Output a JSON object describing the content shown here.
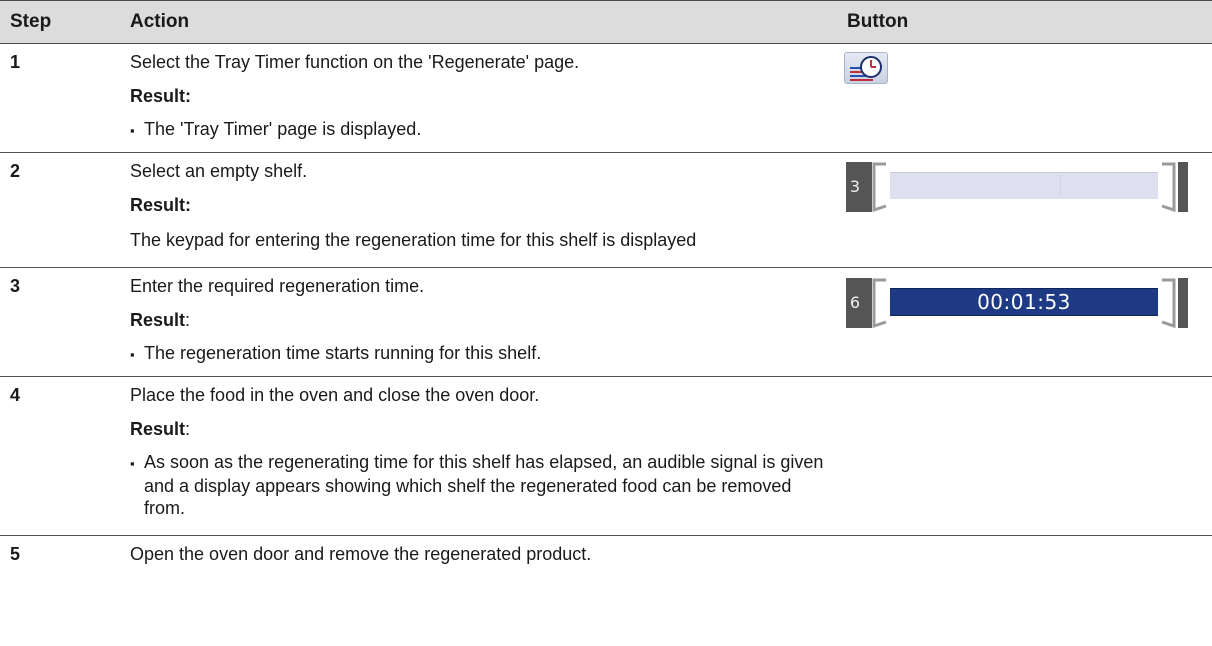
{
  "header": {
    "step": "Step",
    "action": "Action",
    "button": "Button"
  },
  "steps": [
    {
      "num": "1",
      "action": "Select the Tray Timer function on the 'Regenerate' page.",
      "result_label": "Result:",
      "result_suffix": "",
      "result_text": "The 'Tray Timer' page is displayed.",
      "icon": "tray-timer-icon"
    },
    {
      "num": "2",
      "action": "Select an empty shelf.",
      "result_label": "Result:",
      "result_suffix": "",
      "result_text": "The keypad for entering the regeneration time for this shelf is displayed",
      "shelf_label": "3",
      "icon": "empty-shelf-button"
    },
    {
      "num": "3",
      "action": "Enter the required regeneration time.",
      "result_label": "Result",
      "result_suffix": ":",
      "result_text": "The regeneration time starts running for this shelf.",
      "shelf_label": "6",
      "shelf_time": "00:01:53",
      "icon": "running-shelf-button"
    },
    {
      "num": "4",
      "action": "Place the food in the oven and close the oven door.",
      "result_label": "Result",
      "result_suffix": ":",
      "result_text": "As soon as the regenerating time for this shelf has elapsed, an audible signal is given and a display appears showing which shelf the regenerated food can be removed from."
    },
    {
      "num": "5",
      "action": "Open the oven door and remove the regenerated product."
    }
  ],
  "colors": {
    "header_bg": "#dcdcdc",
    "timer_bar": "#1e3a84",
    "empty_bar": "#dfe0ef",
    "rail": "#555555"
  }
}
